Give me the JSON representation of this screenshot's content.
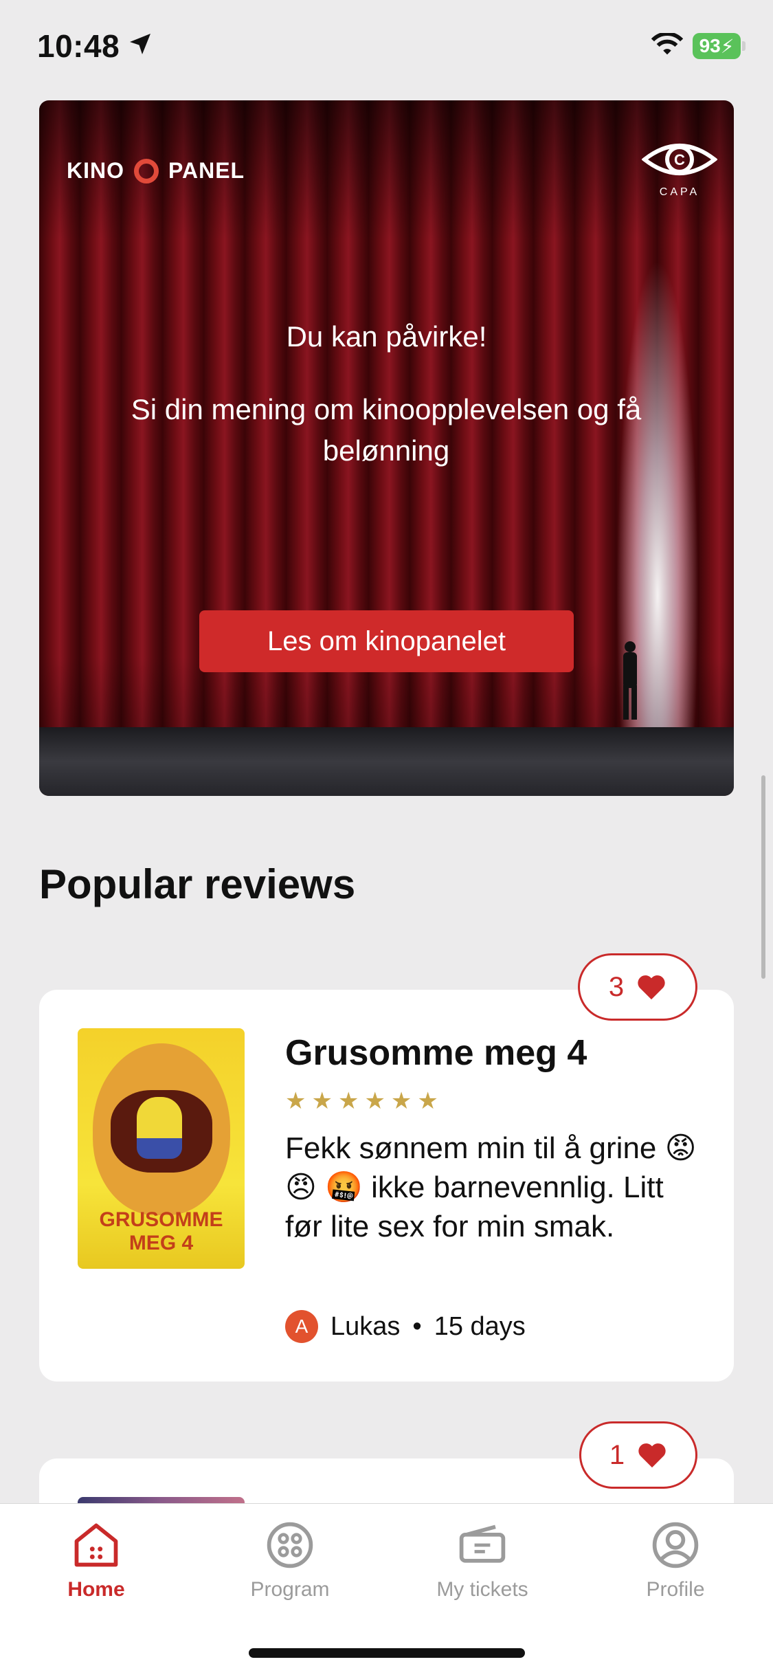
{
  "status_bar": {
    "time": "10:48",
    "battery": "93"
  },
  "banner": {
    "brand_left": "KINO",
    "brand_right": "PANEL",
    "partner": "CAPA",
    "headline": "Du kan påvirke!",
    "body": "Si din mening om kinoopplevelsen og få belønning",
    "cta": "Les om kinopanelet"
  },
  "section": {
    "title": "Popular reviews"
  },
  "reviews": [
    {
      "likes": "3",
      "movie": "Grusomme meg 4",
      "rating": "★★★★★★",
      "text": "Fekk sønnem min til å grine 😡 😠 🤬 ikke barnevennlig. Litt før lite sex for min smak.",
      "avatar_letter": "A",
      "author": "Lukas",
      "age": "15 days",
      "poster_title": "GRUSOMME MEG 4"
    },
    {
      "likes": "1"
    }
  ],
  "tabbar": {
    "home": "Home",
    "program": "Program",
    "tickets": "My tickets",
    "profile": "Profile"
  },
  "colors": {
    "accent": "#c92a2a",
    "cta": "#cf2a2a",
    "stars": "#c9a64a"
  }
}
